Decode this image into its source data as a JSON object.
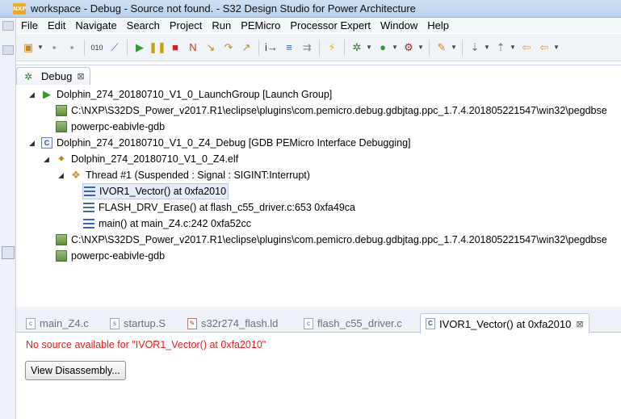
{
  "window": {
    "title": "workspace - Debug - Source not found. - S32 Design Studio for Power Architecture",
    "logo_text": "NXP"
  },
  "menubar": {
    "items": [
      {
        "label": "File"
      },
      {
        "label": "Edit"
      },
      {
        "label": "Navigate"
      },
      {
        "label": "Search"
      },
      {
        "label": "Project"
      },
      {
        "label": "Run"
      },
      {
        "label": "PEMicro"
      },
      {
        "label": "Processor Expert"
      },
      {
        "label": "Window"
      },
      {
        "label": "Help"
      }
    ]
  },
  "toolbar": {
    "icons": [
      "new-icon",
      "save-icon",
      "save-all-icon",
      "binary-icon",
      "skip-breakpoints-icon",
      "resume-icon",
      "suspend-icon",
      "terminate-icon",
      "disconnect-icon",
      "step-into-icon",
      "step-over-icon",
      "step-return-icon",
      "instruction-stepping-icon",
      "drop-to-frame-icon",
      "use-step-filters-icon",
      "flash-icon",
      "debug-icon",
      "run-icon",
      "external-tools-icon",
      "search-icon",
      "annotation-icon",
      "back-icon",
      "forward-icon"
    ]
  },
  "debug_view": {
    "tab_label": "Debug",
    "rows": [
      {
        "label": "Dolphin_274_20180710_V1_0_LaunchGroup [Launch Group]",
        "icon": "launch-group-icon"
      },
      {
        "label": "C:\\NXP\\S32DS_Power_v2017.R1\\eclipse\\plugins\\com.pemicro.debug.gdbjtag.ppc_1.7.4.201805221547\\win32\\pegdbse",
        "icon": "process-icon"
      },
      {
        "label": "powerpc-eabivle-gdb",
        "icon": "process-icon"
      },
      {
        "label": "Dolphin_274_20180710_V1_0_Z4_Debug [GDB PEMicro Interface Debugging]",
        "icon": "c-debug-icon"
      },
      {
        "label": "Dolphin_274_20180710_V1_0_Z4.elf",
        "icon": "elf-icon"
      },
      {
        "label": "Thread #1 (Suspended : Signal : SIGINT:Interrupt)",
        "icon": "thread-icon"
      },
      {
        "label": "IVOR1_Vector() at 0xfa2010",
        "icon": "stack-frame-icon"
      },
      {
        "label": "FLASH_DRV_Erase() at flash_c55_driver.c:653 0xfa49ca",
        "icon": "stack-frame-icon"
      },
      {
        "label": "main() at main_Z4.c:242 0xfa52cc",
        "icon": "stack-frame-icon"
      },
      {
        "label": "C:\\NXP\\S32DS_Power_v2017.R1\\eclipse\\plugins\\com.pemicro.debug.gdbjtag.ppc_1.7.4.201805221547\\win32\\pegdbse",
        "icon": "process-icon"
      },
      {
        "label": "powerpc-eabivle-gdb",
        "icon": "process-icon"
      }
    ]
  },
  "editor": {
    "tabs": [
      {
        "label": "main_Z4.c"
      },
      {
        "label": "startup.S"
      },
      {
        "label": "s32r274_flash.ld"
      },
      {
        "label": "flash_c55_driver.c"
      },
      {
        "label": "IVOR1_Vector() at 0xfa2010",
        "active": true
      }
    ],
    "message": "No source available for \"IVOR1_Vector() at 0xfa2010\"",
    "button_label": "View Disassembly..."
  },
  "colors": {
    "error_text": "#e0201b",
    "selection": "#e4ecf8"
  }
}
